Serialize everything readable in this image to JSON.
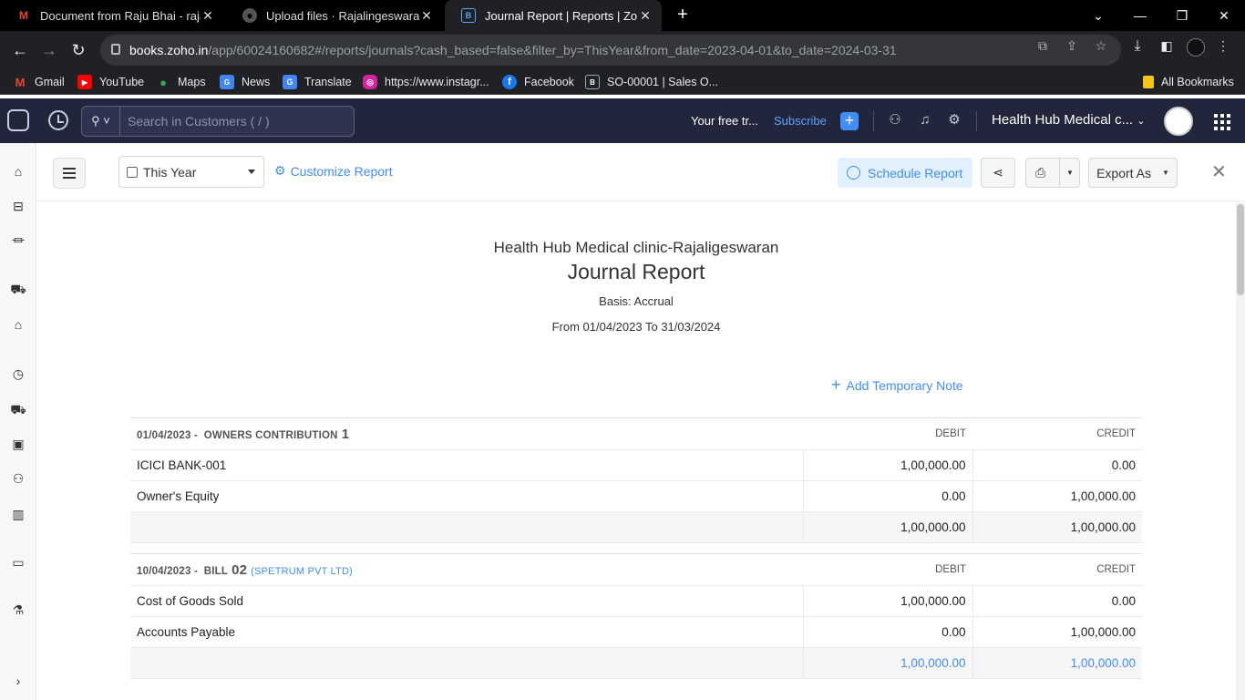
{
  "browser": {
    "tabs": [
      {
        "title": "Document from Raju Bhai - raja",
        "icon": "gmail-icon"
      },
      {
        "title": "Upload files · Rajalingeswaran/H",
        "icon": "github-icon"
      },
      {
        "title": "Journal Report | Reports | Zoho B",
        "icon": "zoho-books-icon"
      }
    ],
    "address": {
      "domain": "books.zoho.in",
      "path": "/app/60024160682#/reports/journals?cash_based=false&filter_by=ThisYear&from_date=2023-04-01&to_date=2024-03-31"
    },
    "bookmarks": [
      "Gmail",
      "YouTube",
      "Maps",
      "News",
      "Translate",
      "https://www.instagr...",
      "Facebook",
      "SO-00001 | Sales O...",
      "All Bookmarks"
    ]
  },
  "header": {
    "search_placeholder": "Search in Customers ( / )",
    "trial": "Your free tr...",
    "subscribe": "Subscribe",
    "org": "Health Hub Medical c..."
  },
  "toolbar": {
    "period": "This Year",
    "customize": "Customize Report",
    "schedule": "Schedule Report",
    "export": "Export As"
  },
  "report": {
    "org": "Health Hub Medical clinic-Rajaligeswaran",
    "title": "Journal Report",
    "basis": "Basis: Accrual",
    "range": "From 01/04/2023 To 31/03/2024",
    "add_note": "Add Temporary Note",
    "debit_label": "DEBIT",
    "credit_label": "CREDIT",
    "entries": [
      {
        "date": "01/04/2023 -",
        "type": "OWNERS CONTRIBUTION",
        "number": "1",
        "customer": "",
        "lines": [
          {
            "account": "ICICI BANK-001",
            "debit": "1,00,000.00",
            "credit": "0.00"
          },
          {
            "account": "Owner's Equity",
            "debit": "0.00",
            "credit": "1,00,000.00"
          }
        ],
        "total_debit": "1,00,000.00",
        "total_credit": "1,00,000.00"
      },
      {
        "date": "10/04/2023 -",
        "type": "BILL",
        "number": "02",
        "customer": "(SPETRUM PVT LTD)",
        "lines": [
          {
            "account": "Cost of Goods Sold",
            "debit": "1,00,000.00",
            "credit": "0.00"
          },
          {
            "account": "Accounts Payable",
            "debit": "0.00",
            "credit": "1,00,000.00"
          }
        ],
        "total_debit": "1,00,000.00",
        "total_credit": "1,00,000.00"
      }
    ]
  }
}
